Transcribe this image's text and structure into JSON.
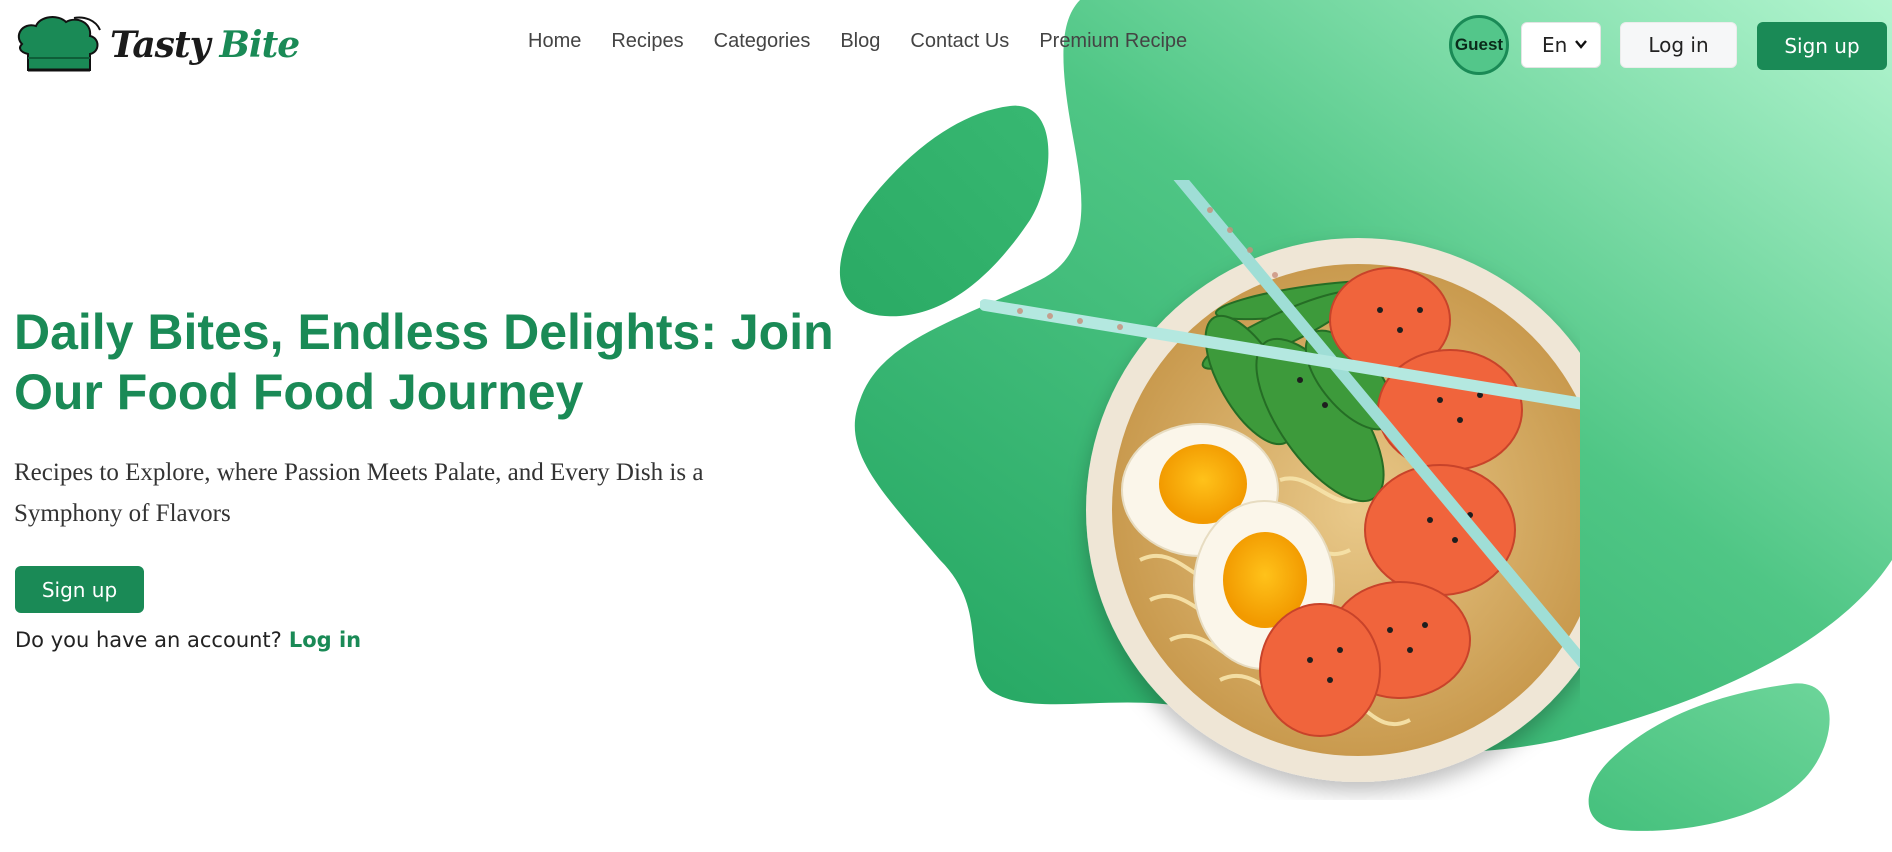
{
  "brand": {
    "name_part1": "Tasty",
    "name_part2": "Bite"
  },
  "nav": {
    "items": [
      {
        "label": "Home"
      },
      {
        "label": "Recipes"
      },
      {
        "label": "Categories"
      },
      {
        "label": "Blog"
      },
      {
        "label": "Contact Us"
      },
      {
        "label": "Premium Recipe"
      }
    ]
  },
  "header": {
    "guest_label": "Guest",
    "language": "En",
    "login_label": "Log in",
    "signup_label": "Sign up"
  },
  "hero": {
    "title": "Daily Bites, Endless Delights: Join Our Food Food Journey",
    "subtitle": "Recipes to Explore, where Passion Meets Palate, and Every Dish is a Symphony of Flavors",
    "signup_label": "Sign up",
    "account_prompt": "Do you have an account?",
    "login_link": "Log in"
  },
  "colors": {
    "brand_green": "#1a8a56",
    "blob_green": "#2eb06a",
    "blob_light": "#a8f0c8"
  },
  "icons": {
    "logo": "chef-hat-icon",
    "language_dropdown": "chevron-down-icon"
  }
}
